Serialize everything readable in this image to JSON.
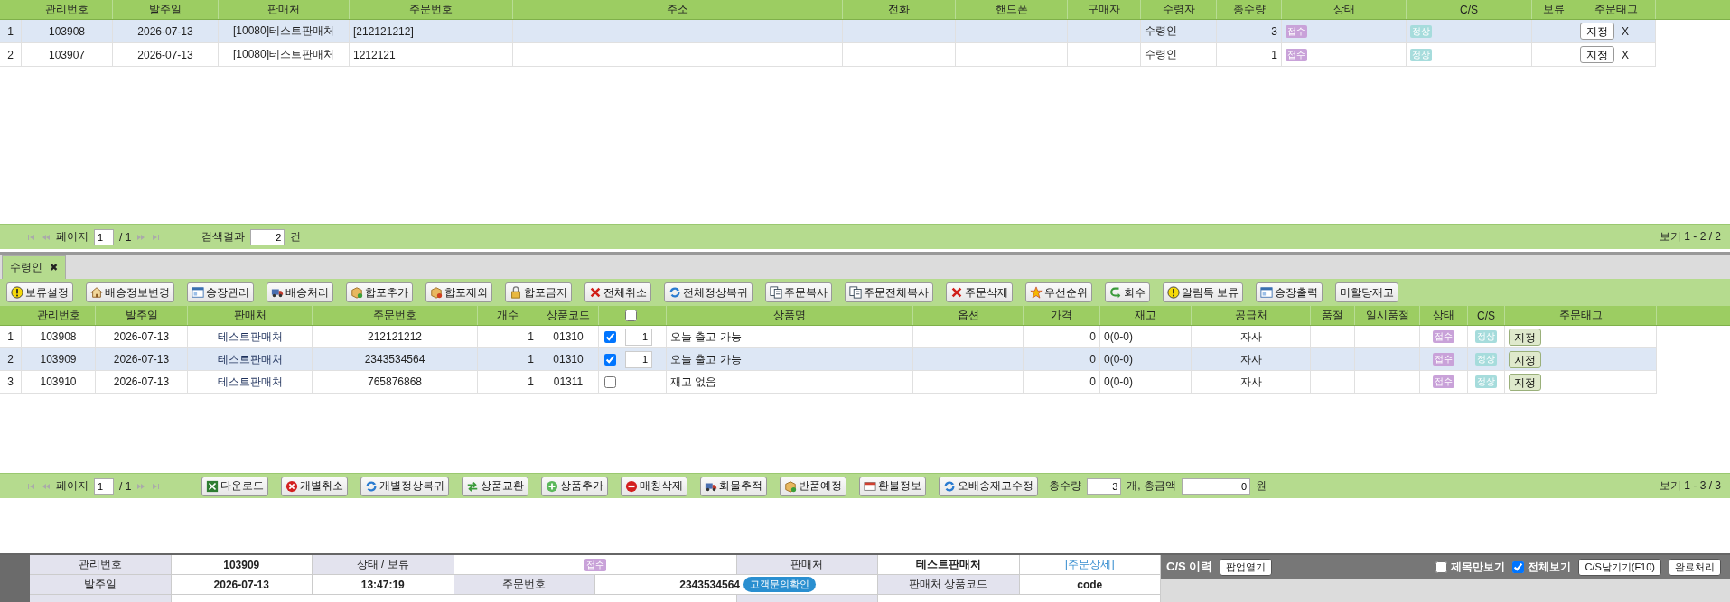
{
  "order_grid": {
    "columns": [
      "관리번호",
      "발주일",
      "판매처",
      "주문번호",
      "주소",
      "전화",
      "핸드폰",
      "구매자",
      "수령자",
      "총수량",
      "상태",
      "C/S",
      "보류",
      "주문태그"
    ],
    "rows": [
      {
        "no": "1",
        "id": "103908",
        "date": "2026-07-13",
        "seller": "[10080]테스트판매처",
        "order_no": "[212121212]",
        "receiver": "수령인",
        "qty": "3",
        "status": "접수",
        "cs": "정상",
        "tag_button": "지정",
        "remove": "X",
        "selected": true
      },
      {
        "no": "2",
        "id": "103907",
        "date": "2026-07-13",
        "seller": "[10080]테스트판매처",
        "order_no": "1212121",
        "receiver": "수령인",
        "qty": "1",
        "status": "접수",
        "cs": "정상",
        "tag_button": "지정",
        "remove": "X",
        "selected": false
      }
    ]
  },
  "order_pager": {
    "page_label": "페이지",
    "page": "1",
    "total_pages": "/ 1",
    "result_label": "검색결과",
    "result_count": "2",
    "result_unit": "건",
    "summary": "보기 1 - 2 / 2"
  },
  "tabs": [
    {
      "label": "수령인",
      "close": "✖",
      "selected": true
    }
  ],
  "toolbar": [
    "보류설정",
    "배송정보변경",
    "송장관리",
    "배송처리",
    "합포추가",
    "합포제외",
    "합포금지",
    "전체취소",
    "전체정상복귀",
    "주문복사",
    "주문전체복사",
    "주문삭제",
    "우선순위",
    "회수",
    "알림톡 보류",
    "송장출력",
    "미할당재고"
  ],
  "item_grid": {
    "columns": [
      "관리번호",
      "발주일",
      "판매처",
      "주문번호",
      "개수",
      "상품코드",
      "상품명",
      "옵션",
      "가격",
      "재고",
      "공급처",
      "품절",
      "일시품절",
      "상태",
      "C/S",
      "주문태그"
    ],
    "select_all_checked": false,
    "rows": [
      {
        "no": "1",
        "id": "103908",
        "date": "2026-07-13",
        "seller": "테스트판매처",
        "order_no": "212121212",
        "count": "1",
        "product_code": "01310",
        "checked": true,
        "pick_qty": "1",
        "product_name": "오늘 출고 가능",
        "price": "0",
        "stock": "0(0-0)",
        "supplier": "자사",
        "status": "접수",
        "cs": "정상",
        "tag_button": "지정",
        "selected": false
      },
      {
        "no": "2",
        "id": "103909",
        "date": "2026-07-13",
        "seller": "테스트판매처",
        "order_no": "2343534564",
        "count": "1",
        "product_code": "01310",
        "checked": true,
        "pick_qty": "1",
        "product_name": "오늘 출고 가능",
        "price": "0",
        "stock": "0(0-0)",
        "supplier": "자사",
        "status": "접수",
        "cs": "정상",
        "tag_button": "지정",
        "selected": true
      },
      {
        "no": "3",
        "id": "103910",
        "date": "2026-07-13",
        "seller": "테스트판매처",
        "order_no": "765876868",
        "count": "1",
        "product_code": "01311",
        "checked": false,
        "product_name": "재고 없음",
        "price": "0",
        "stock": "0(0-0)",
        "supplier": "자사",
        "status": "접수",
        "cs": "정상",
        "tag_button": "지정",
        "selected": false
      }
    ]
  },
  "item_pager": {
    "page_label": "페이지",
    "page": "1",
    "total_pages": "/ 1",
    "buttons": [
      "다운로드",
      "개별취소",
      "개별정상복귀",
      "상품교환",
      "상품추가",
      "매칭삭제",
      "화물추적",
      "반품예정",
      "환불정보",
      "오배송재고수정"
    ],
    "total_qty_label": "총수량",
    "total_qty": "3",
    "total_amount_label": "개, 총금액",
    "total_amount": "0",
    "currency": "원",
    "summary": "보기 1 - 3 / 3"
  },
  "detail": {
    "order_id_label": "관리번호",
    "order_id": "103909",
    "status_label": "상태 / 보류",
    "status": "접수",
    "seller_label": "판매처",
    "seller": "테스트판매처",
    "detail_link": "[주문상세]",
    "date_label": "발주일",
    "date": "2026-07-13",
    "time": "13:47:19",
    "order_no_label": "주문번호",
    "order_no": "2343534564",
    "inquiry_button": "고객문의확인",
    "seller_code_label": "판매처 상품코드",
    "seller_code": "code"
  },
  "cs_history": {
    "title": "C/S 이력",
    "popup_button": "팝업열기",
    "title_only": {
      "label": "제목만보기",
      "checked": false
    },
    "show_all": {
      "label": "전체보기",
      "checked": true
    },
    "write_button": "C/S남기기(F10)",
    "complete_button": "완료처리"
  }
}
